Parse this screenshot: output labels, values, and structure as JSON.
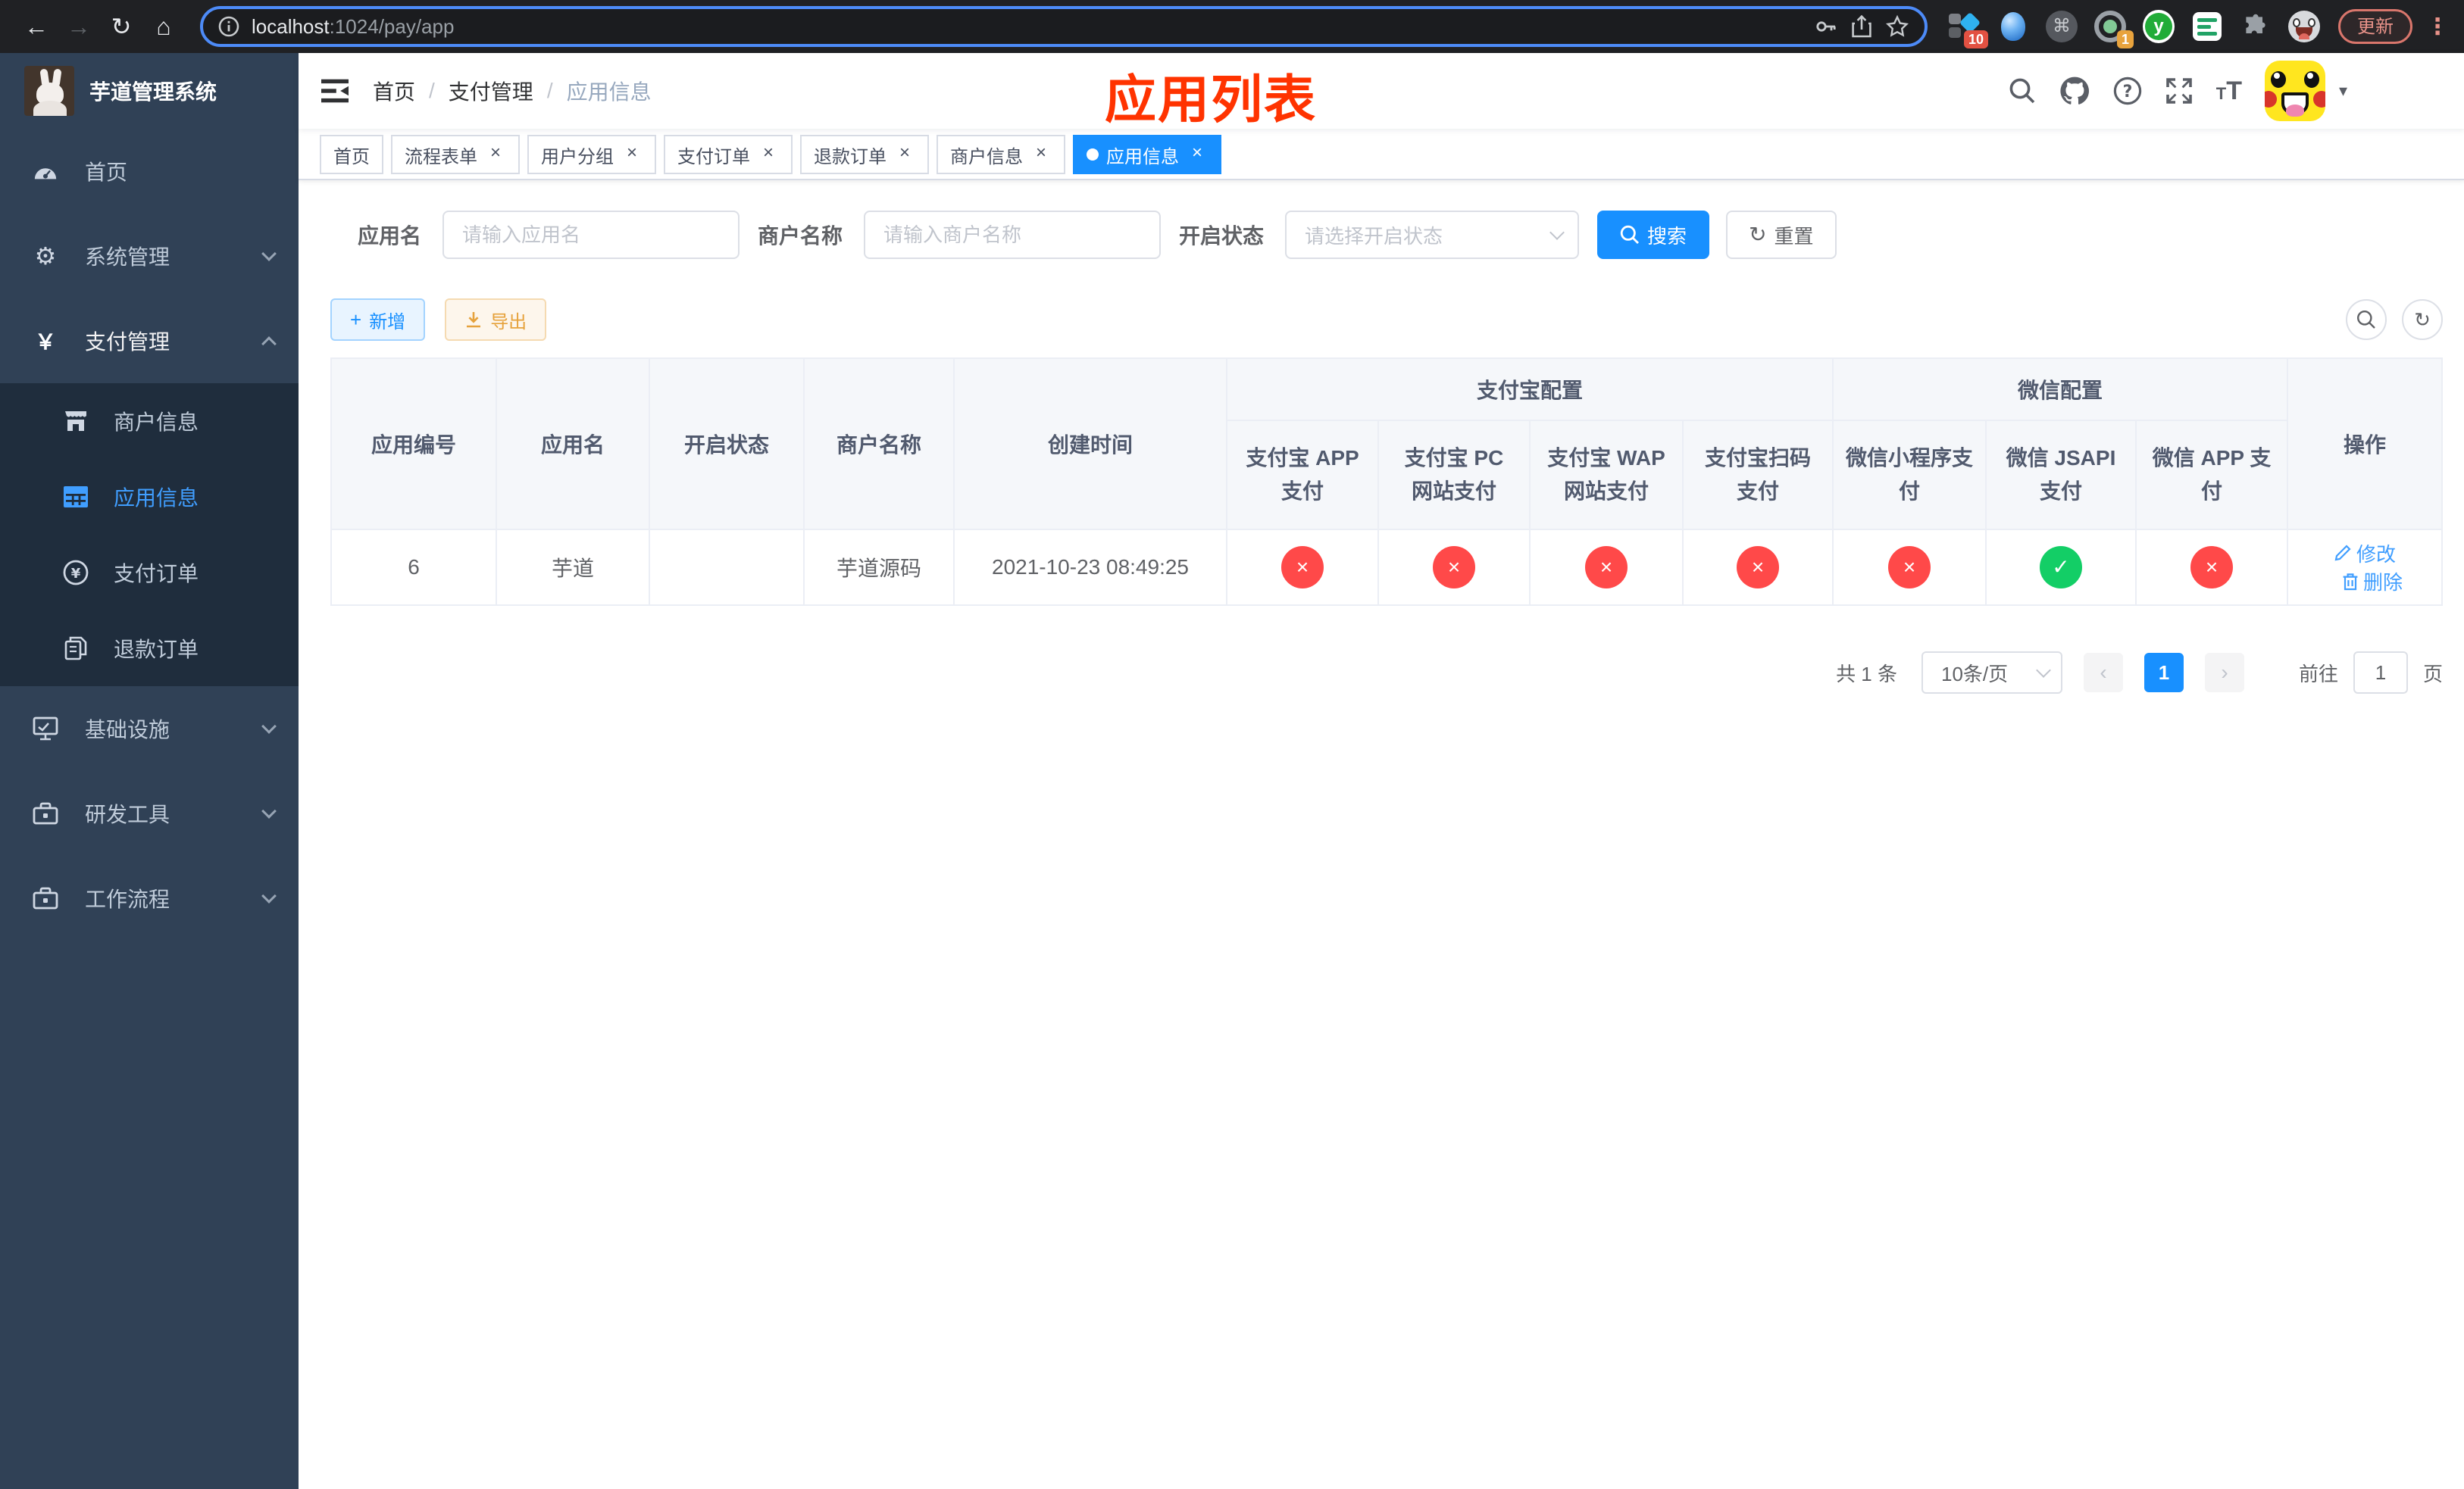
{
  "browser": {
    "url_host": "localhost",
    "url_rest": ":1024/pay/app",
    "update_button": "更新",
    "ext_badge_blue_diamond": "10",
    "ext_badge_recorder": "1",
    "ext_y_label": "y"
  },
  "sidebar": {
    "title": "芋道管理系统",
    "items": [
      {
        "label": "首页"
      },
      {
        "label": "系统管理"
      },
      {
        "label": "支付管理"
      },
      {
        "label": "基础设施"
      },
      {
        "label": "研发工具"
      },
      {
        "label": "工作流程"
      }
    ],
    "pay_submenu": [
      {
        "label": "商户信息"
      },
      {
        "label": "应用信息"
      },
      {
        "label": "支付订单"
      },
      {
        "label": "退款订单"
      }
    ]
  },
  "header": {
    "breadcrumb": [
      "首页",
      "支付管理",
      "应用信息"
    ],
    "separator": "/",
    "overlay_title": "应用列表"
  },
  "tabs": [
    {
      "label": "首页"
    },
    {
      "label": "流程表单"
    },
    {
      "label": "用户分组"
    },
    {
      "label": "支付订单"
    },
    {
      "label": "退款订单"
    },
    {
      "label": "商户信息"
    },
    {
      "label": "应用信息"
    }
  ],
  "filters": {
    "app_name_label": "应用名",
    "app_name_placeholder": "请输入应用名",
    "merchant_label": "商户名称",
    "merchant_placeholder": "请输入商户名称",
    "status_label": "开启状态",
    "status_placeholder": "请选择开启状态",
    "search_button": "搜索",
    "reset_button": "重置"
  },
  "toolbar": {
    "add_button": "新增",
    "export_button": "导出"
  },
  "table": {
    "columns": [
      "应用编号",
      "应用名",
      "开启状态",
      "商户名称",
      "创建时间"
    ],
    "group_alipay": "支付宝配置",
    "group_wechat": "微信配置",
    "pay_columns": [
      "支付宝 APP 支付",
      "支付宝 PC 网站支付",
      "支付宝 WAP 网站支付",
      "支付宝扫码支付",
      "微信小程序支付",
      "微信 JSAPI 支付",
      "微信 APP 支付"
    ],
    "operation": "操作",
    "row": {
      "id": "6",
      "name": "芋道",
      "enabled": true,
      "merchant_name": "芋道源码",
      "create_time": "2021-10-23 08:49:25",
      "pay_status": [
        false,
        false,
        false,
        false,
        false,
        true,
        false
      ]
    },
    "actions": {
      "edit": "修改",
      "delete": "删除"
    }
  },
  "pagination": {
    "total": "共 1 条",
    "page_size": "10条/页",
    "current_page": "1",
    "goto_label": "前往",
    "goto_value": "1",
    "page_unit": "页"
  },
  "colors": {
    "primary": "#1890ff",
    "sidebar_active": "#409eff",
    "success": "#13ce66",
    "danger": "#ff4949",
    "overlay_title": "#ff3300"
  }
}
